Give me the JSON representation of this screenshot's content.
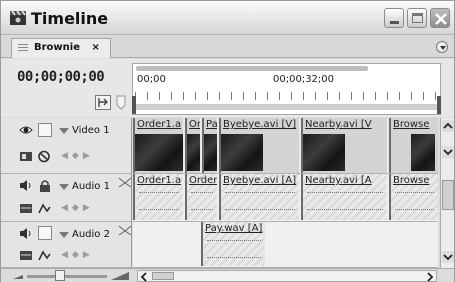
{
  "window": {
    "title": "Timeline",
    "icons": [
      "film-clapper-icon",
      "minimize-icon",
      "maximize-icon",
      "close-icon"
    ]
  },
  "tabs": [
    {
      "label": "Brownie",
      "close_label": "×",
      "active": true
    }
  ],
  "header": {
    "timecode": "00;00;00;00",
    "ruler_labels": [
      "00;00",
      "00;00;32;00"
    ]
  },
  "video_tracks": [
    {
      "name": "Video 1",
      "clips": [
        {
          "name": "Order1.a"
        },
        {
          "name": "Or"
        },
        {
          "name": "Pa"
        },
        {
          "name": "Byebye.avi [V]"
        },
        {
          "name": "Nearby.avi [V"
        },
        {
          "name": "Browse"
        }
      ]
    }
  ],
  "audio_tracks": [
    {
      "name": "Audio 1",
      "clips": [
        {
          "name": "Order1.a"
        },
        {
          "name": "Order"
        },
        {
          "name": "Byebye.avi [A]"
        },
        {
          "name": "Nearby.avi [A"
        },
        {
          "name": "Browse"
        }
      ]
    },
    {
      "name": "Audio 2",
      "clips": [
        {
          "name": "Pay.wav [A]"
        }
      ]
    }
  ],
  "colors": {
    "chrome": "#dcdcdc",
    "clip_video": "#d3d3d3",
    "clip_audio": "#e2e2e2",
    "close_button": "#9a9a9a"
  }
}
